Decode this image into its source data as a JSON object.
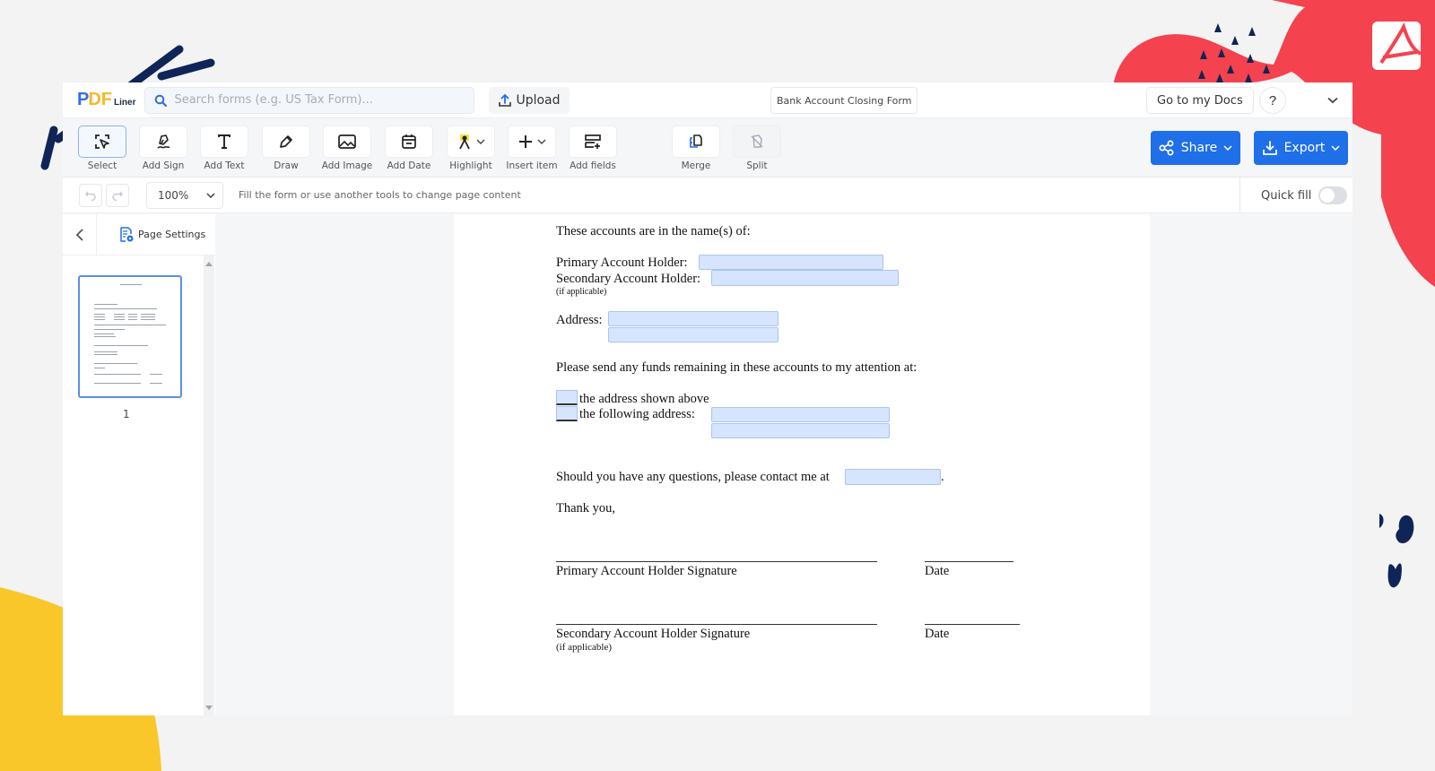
{
  "header": {
    "logo": {
      "p": "P",
      "d": "D",
      "f": "F",
      "suffix": "Liner"
    },
    "search_placeholder": "Search forms (e.g. US Tax Form)...",
    "upload_label": "Upload",
    "document_title": "Bank Account Closing Form",
    "go_to_docs_label": "Go to my Docs",
    "help_label": "?"
  },
  "toolbar": {
    "tools": [
      {
        "label": "Select",
        "icon": "select-cursor-icon",
        "active": true
      },
      {
        "label": "Add Sign",
        "icon": "signature-icon"
      },
      {
        "label": "Add Text",
        "icon": "text-icon"
      },
      {
        "label": "Draw",
        "icon": "pen-icon"
      },
      {
        "label": "Add Image",
        "icon": "image-icon"
      },
      {
        "label": "Add Date",
        "icon": "calendar-icon"
      },
      {
        "label": "Highlight",
        "icon": "highlighter-icon",
        "dropdown": true
      },
      {
        "label": "Insert item",
        "icon": "plus-icon",
        "dropdown": true
      },
      {
        "label": "Add fields",
        "icon": "add-fields-icon"
      },
      {
        "label": "Merge",
        "icon": "merge-icon"
      },
      {
        "label": "Split",
        "icon": "split-icon"
      }
    ],
    "share_label": "Share",
    "export_label": "Export",
    "accent_color": "#1f6fe8"
  },
  "subbar": {
    "zoom_value": "100%",
    "hint": "Fill the form or use another tools to change page content",
    "quick_fill_label": "Quick fill",
    "quick_fill_enabled": false
  },
  "sidebar": {
    "page_settings_label": "Page Settings",
    "pages": [
      {
        "number": "1",
        "selected": true
      }
    ]
  },
  "document": {
    "intro": "These accounts are in the name(s) of:",
    "primary_holder_label": "Primary Account Holder:",
    "secondary_holder_label": "Secondary Account Holder:",
    "if_applicable": "(if applicable)",
    "address_label": "Address:",
    "funds_text": "Please send any funds remaining in these accounts to my attention at:",
    "option_above": "the address shown above",
    "option_following": "the following address:",
    "contact_text": "Should you have any questions, please contact me at",
    "contact_period": ".",
    "thank_you": "Thank you,",
    "primary_signature_label": "Primary Account Holder Signature",
    "secondary_signature_label": "Secondary Account Holder Signature",
    "date_label": "Date",
    "field_color": "#d6e5fd"
  }
}
